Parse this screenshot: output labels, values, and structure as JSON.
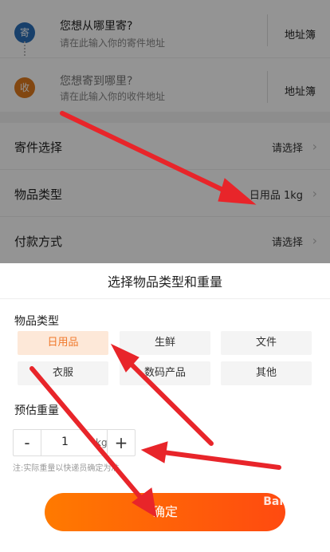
{
  "address": {
    "sender": {
      "badge": "寄",
      "title": "您想从哪里寄?",
      "subtitle": "请在此输入你的寄件地址",
      "book": "地址簿"
    },
    "receiver": {
      "badge": "收",
      "title": "您想寄到哪里?",
      "subtitle": "请在此输入你的收件地址",
      "book": "地址簿"
    }
  },
  "options": [
    {
      "label": "寄件选择",
      "value": "请选择"
    },
    {
      "label": "物品类型",
      "value": "日用品 1kg"
    },
    {
      "label": "付款方式",
      "value": "请选择"
    }
  ],
  "sheet": {
    "title": "选择物品类型和重量",
    "type_label": "物品类型",
    "types": [
      "日用品",
      "生鲜",
      "文件",
      "衣服",
      "数码产品",
      "其他"
    ],
    "selected_type": "日用品",
    "weight_label": "预估重量",
    "weight_value": "1",
    "weight_unit": "kg",
    "minus": "-",
    "plus": "+",
    "note": "注:实际重量以快递员确定为准",
    "confirm": "确定"
  },
  "colors": {
    "sender_badge": "#2a6fb8",
    "receiver_badge": "#e07a1e",
    "accent": "#f0782a",
    "arrow": "#e8252a"
  },
  "watermark": "Baidu 经验"
}
